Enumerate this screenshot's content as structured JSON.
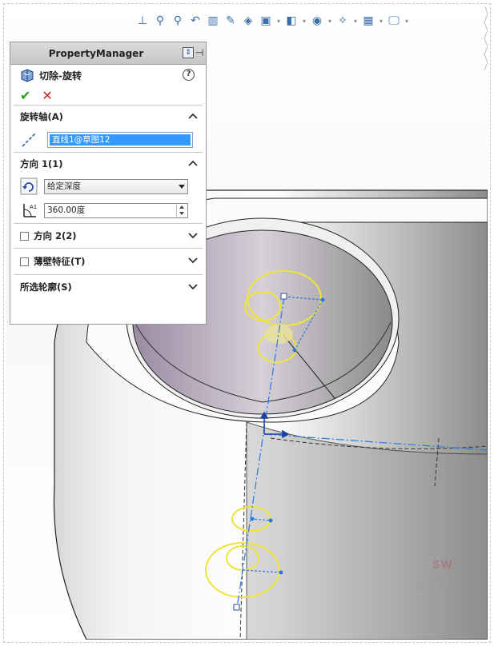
{
  "toolbar": {
    "icons": [
      "view-orient-icon",
      "zoom-fit-icon",
      "zoom-area-icon",
      "previous-view-icon",
      "section-view-icon",
      "dynamic-annotation-icon",
      "view-orientation-icon",
      "display-style-icon",
      "hide-show-icon",
      "edit-appearance-icon",
      "apply-scene-icon",
      "view-settings-icon",
      "monitor-icon"
    ]
  },
  "pm": {
    "header_title": "PropertyManager",
    "feature_title": "切除-旋转",
    "help_label": "?",
    "ok_label": "✔",
    "cancel_label": "✕",
    "axis_group": {
      "title": "旋转轴(A)",
      "selection": "直线1@草图12"
    },
    "dir1_group": {
      "title": "方向 1(1)",
      "end_condition": "给定深度",
      "angle": "360.00度"
    },
    "dir2_group": {
      "title": "方向 2(2)"
    },
    "thin_group": {
      "title": "薄壁特征(T)"
    },
    "contours_group": {
      "title": "所选轮廓(S)"
    }
  },
  "watermark": {
    "top": "SW",
    "mid": "研习社"
  },
  "colors": {
    "sketch": "#f0e43a",
    "axis": "#2a78e0",
    "selection": "#3399ff",
    "accept": "#2a9a1c",
    "reject": "#cc1f1f"
  }
}
